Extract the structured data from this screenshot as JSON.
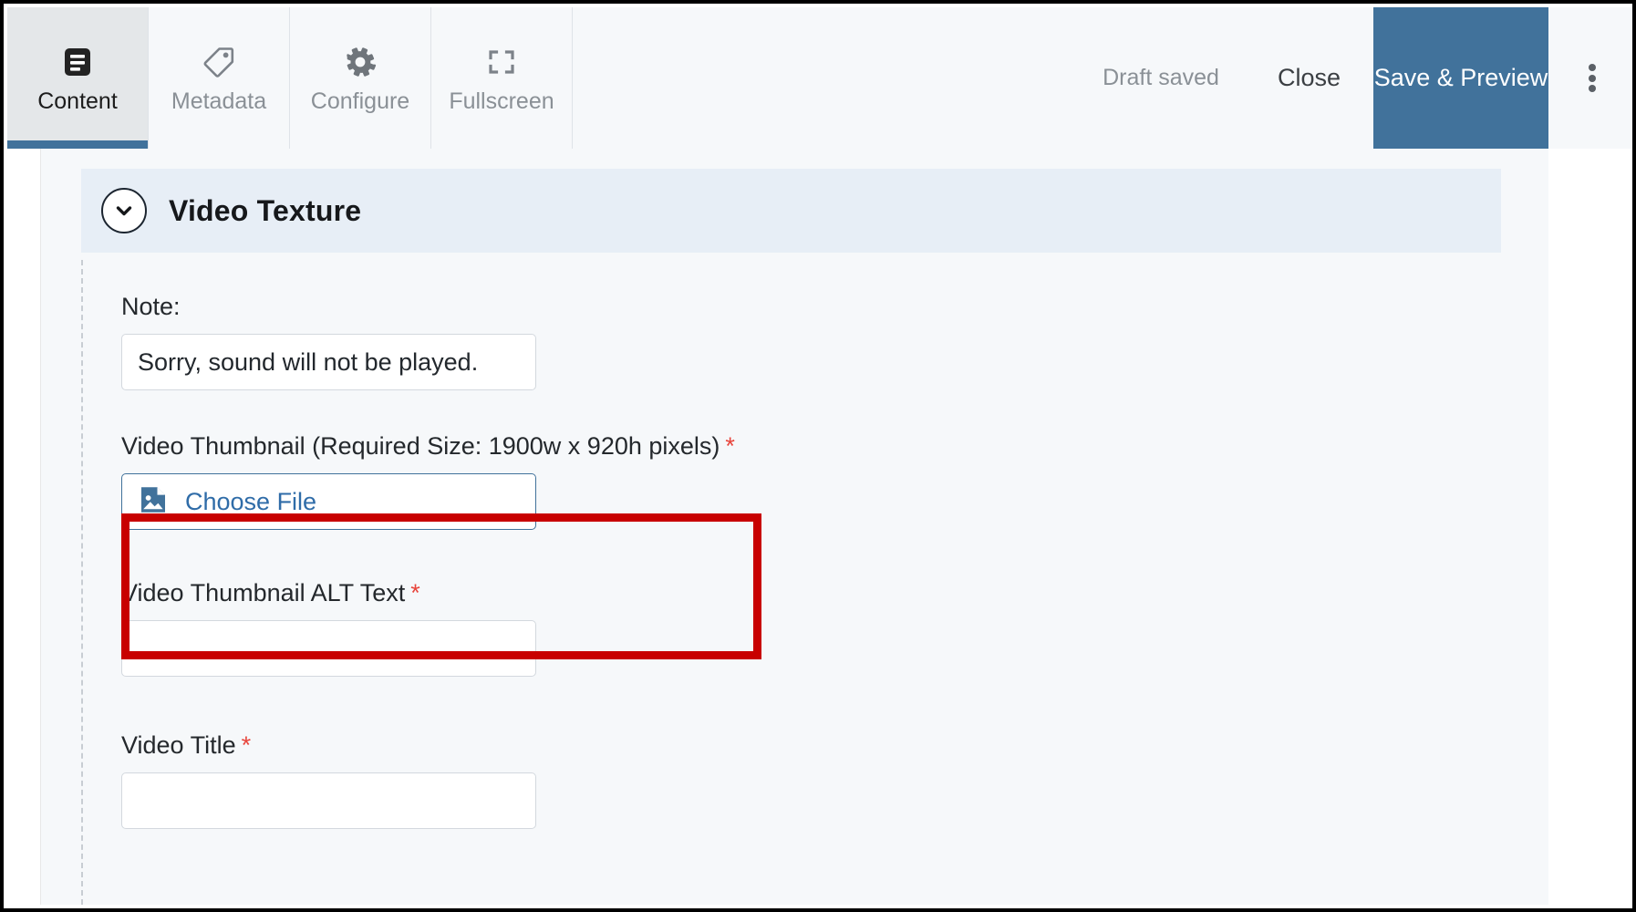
{
  "toolbar": {
    "tabs": [
      {
        "label": "Content",
        "icon": "document-lines-icon",
        "active": true
      },
      {
        "label": "Metadata",
        "icon": "tag-icon",
        "active": false
      },
      {
        "label": "Configure",
        "icon": "gear-icon",
        "active": false
      },
      {
        "label": "Fullscreen",
        "icon": "fullscreen-icon",
        "active": false
      }
    ],
    "draft_status": "Draft saved",
    "close_label": "Close",
    "save_preview_label": "Save & Preview",
    "overflow_icon": "kebab-menu-icon",
    "accent_color": "#41729b",
    "active_tab_bg": "#e4e7e9"
  },
  "section": {
    "title": "Video Texture",
    "collapse_icon": "chevron-down-circle-icon",
    "header_bg": "#e7eef6"
  },
  "form": {
    "note": {
      "label": "Note:",
      "value": "Sorry, sound will not be played.",
      "placeholder": ""
    },
    "video_thumbnail": {
      "label": "Video Thumbnail (Required Size: 1900w x 920h pixels)",
      "required_marker": "*",
      "button_label": "Choose File",
      "button_icon": "image-file-icon",
      "highlighted": true,
      "highlight_color": "#c80000"
    },
    "video_thumbnail_alt": {
      "label": "Video Thumbnail ALT Text",
      "required_marker": "*",
      "value": "",
      "placeholder": ""
    },
    "video_title": {
      "label": "Video Title",
      "required_marker": "*",
      "value": "",
      "placeholder": ""
    }
  },
  "colors": {
    "required_star": "#e8453c",
    "link_blue": "#2f6ca8",
    "page_bg": "#f6f8fa"
  }
}
